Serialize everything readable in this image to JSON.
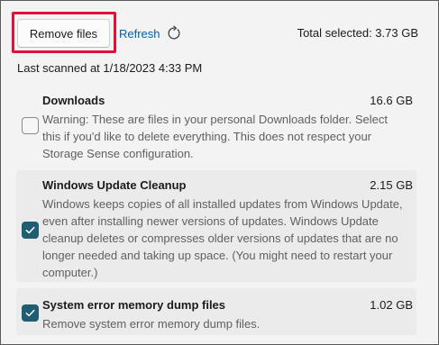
{
  "toolbar": {
    "remove_label": "Remove files",
    "refresh_label": "Refresh",
    "total_selected": "Total selected: 3.73 GB"
  },
  "last_scanned": "Last scanned at 1/18/2023 4:33 PM",
  "colors": {
    "highlight": "#e0113a",
    "link": "#005fb8",
    "checkbox_checked": "#1f5d72"
  },
  "items": [
    {
      "title": "Downloads",
      "size": "16.6 GB",
      "checked": false,
      "description": "Warning: These are files in your personal Downloads folder. Select this if you'd like to delete everything. This does not respect your Storage Sense configuration."
    },
    {
      "title": "Windows Update Cleanup",
      "size": "2.15 GB",
      "checked": true,
      "description": "Windows keeps copies of all installed updates from Windows Update, even after installing newer versions of updates. Windows Update cleanup deletes or compresses older versions of updates that are no longer needed and taking up space. (You might need to restart your computer.)"
    },
    {
      "title": "System error memory dump files",
      "size": "1.02 GB",
      "checked": true,
      "description": "Remove system error memory dump files."
    }
  ]
}
